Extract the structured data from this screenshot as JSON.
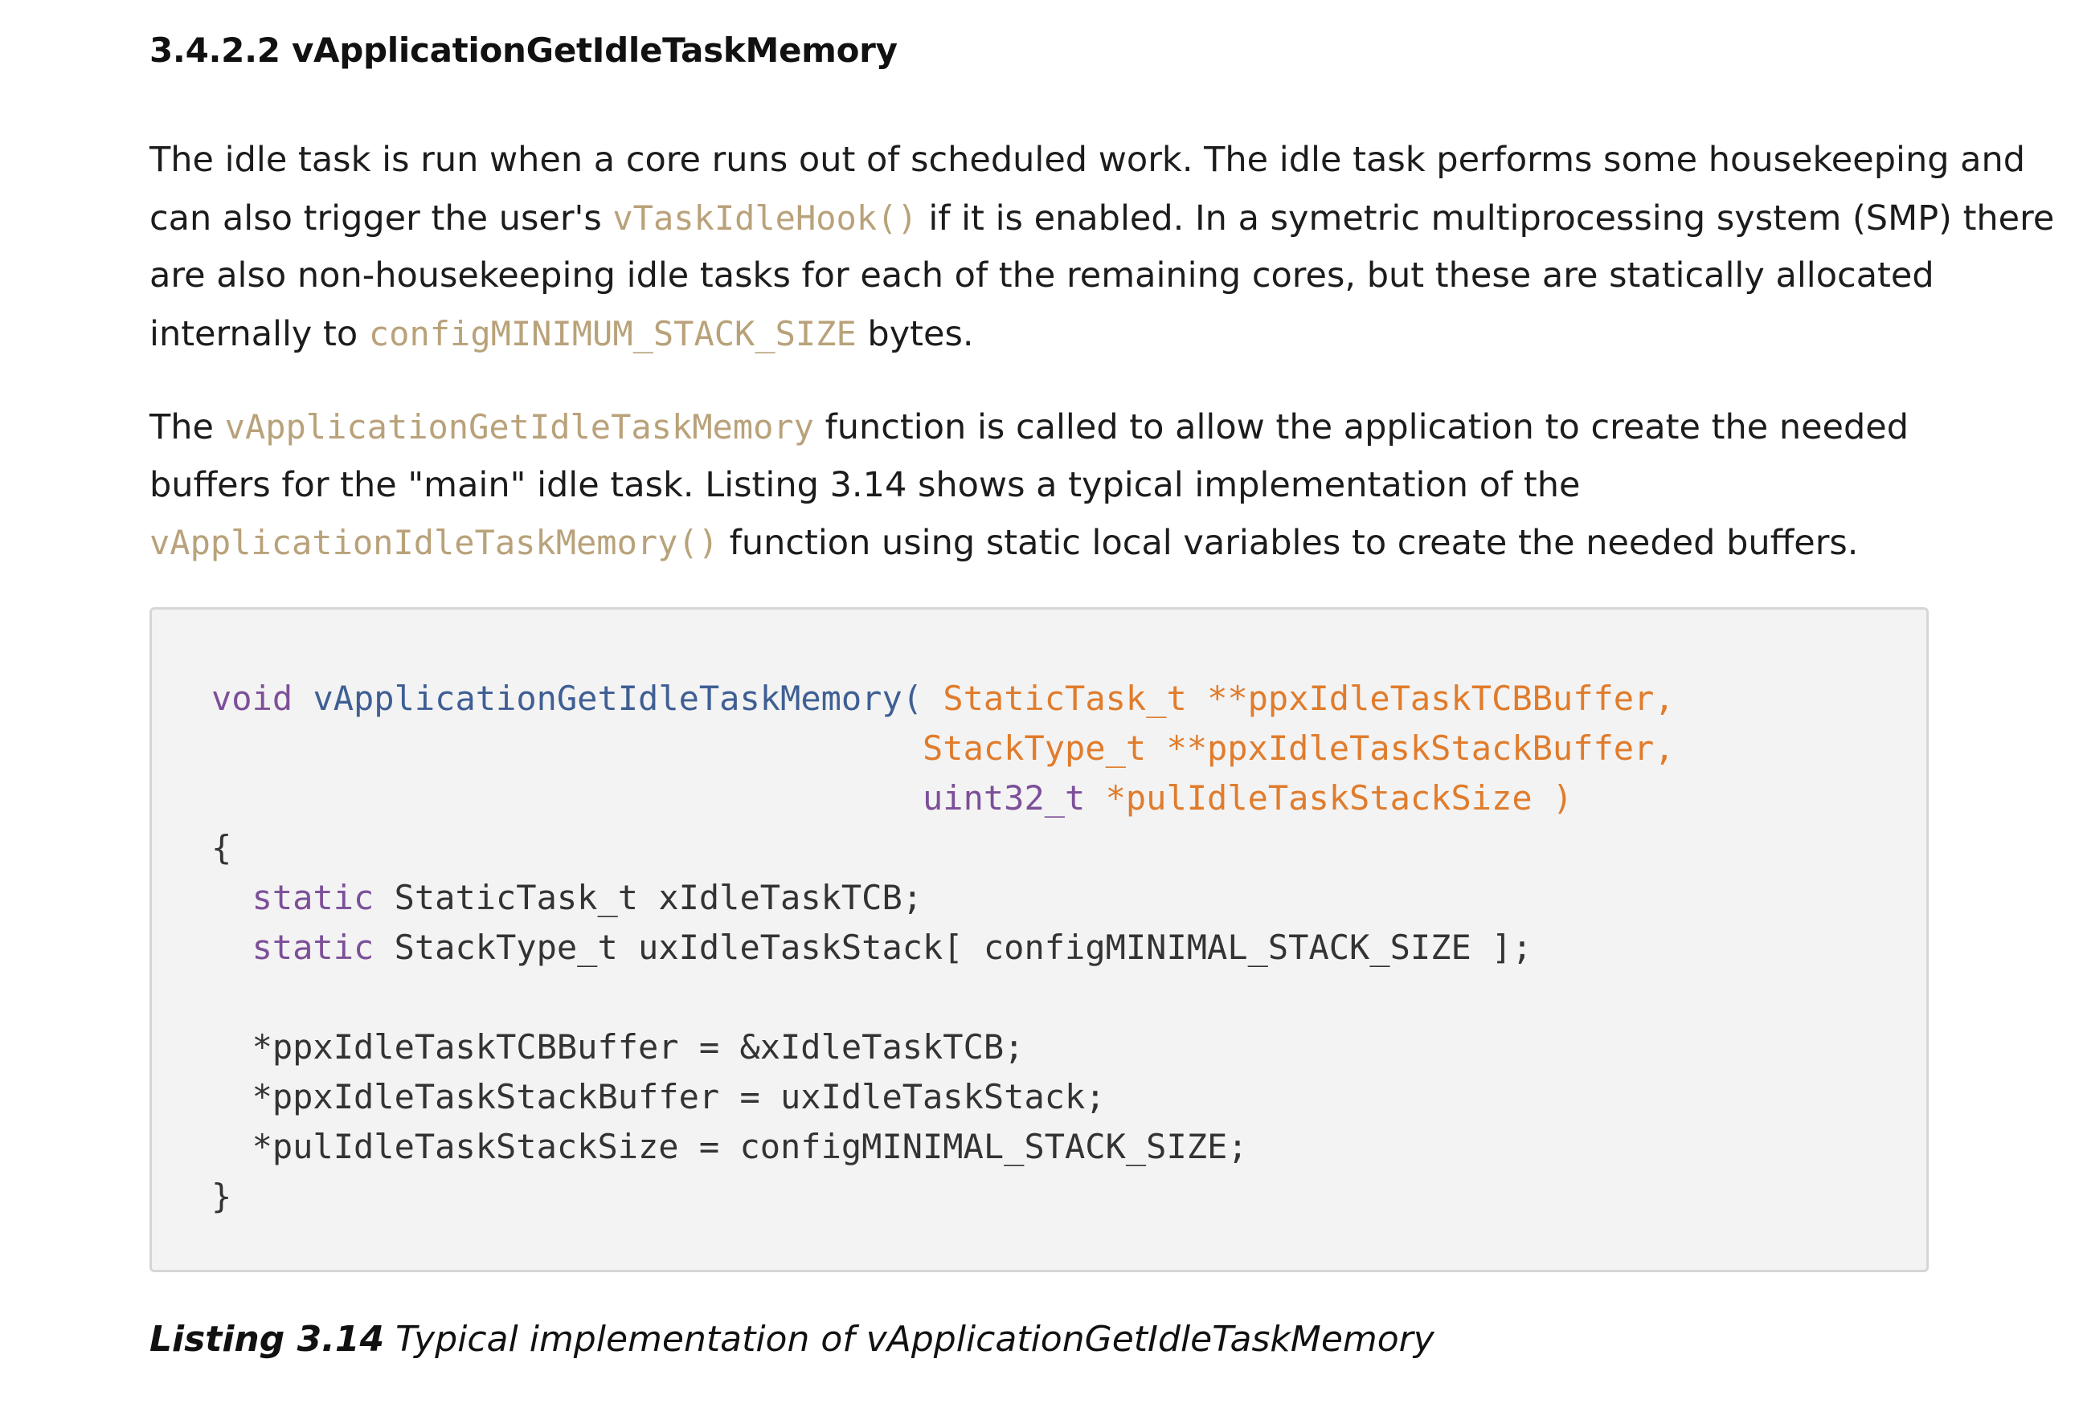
{
  "heading": "3.4.2.2 vApplicationGetIdleTaskMemory",
  "paragraph1": {
    "l1": "The idle task is run when a core runs out of scheduled work. The idle task performs some housekeeping and",
    "l2_pre": "can also trigger the user's ",
    "l2_code": "vTaskIdleHook()",
    "l2_post": " if it is enabled. In a symetric multiprocessing system (SMP) there",
    "l3": "are also non-housekeeping idle tasks for each of the remaining cores, but these are statically allocated",
    "l4_pre": "internally to ",
    "l4_code": "configMINIMUM_STACK_SIZE",
    "l4_post": " bytes."
  },
  "paragraph2": {
    "l1_pre": "The ",
    "l1_code": "vApplicationGetIdleTaskMemory",
    "l1_post": " function is called to allow the application to create the needed",
    "l2": "buffers for the \"main\" idle task. Listing 3.14 shows a typical implementation of the",
    "l3_code": "vApplicationIdleTaskMemory()",
    "l3_post": " function using static local variables to create the needed buffers."
  },
  "code": {
    "l1_kw": "void",
    "l1_fn": "vApplicationGetIdleTaskMemory(",
    "l1_pm": "StaticTask_t **ppxIdleTaskTCBBuffer,",
    "l2_pm": "StackType_t **ppxIdleTaskStackBuffer,",
    "l3_kw": "uint32_t",
    "l3_pm": "*pulIdleTaskStackSize )",
    "l4": "{",
    "l5_kw": "static",
    "l5_tx": "StaticTask_t xIdleTaskTCB;",
    "l6_kw": "static",
    "l6_tx": "StackType_t uxIdleTaskStack[ configMINIMAL_STACK_SIZE ];",
    "l8": "*ppxIdleTaskTCBBuffer = &xIdleTaskTCB;",
    "l9": "*ppxIdleTaskStackBuffer = uxIdleTaskStack;",
    "l10": "*pulIdleTaskStackSize = configMINIMAL_STACK_SIZE;",
    "l11": "}"
  },
  "caption": {
    "label": "Listing 3.14",
    "text": " Typical implementation of vApplicationGetIdleTaskMemory"
  },
  "colors": {
    "inline_code": "#b9a27a",
    "keyword": "#7d4f99",
    "function": "#3f5f94",
    "parameter": "#e07c2c",
    "code_background": "#f3f3f3"
  }
}
